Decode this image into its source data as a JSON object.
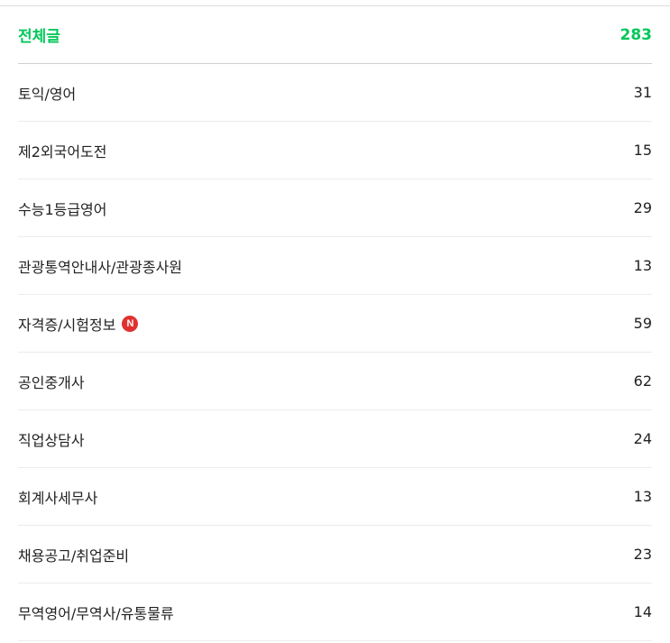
{
  "all_posts": {
    "label": "전체글",
    "count": "283"
  },
  "new_badge": "N",
  "accent_color": "#03c75a",
  "badge_color": "#e0312f",
  "categories": [
    {
      "label": "토익/영어",
      "count": "31"
    },
    {
      "label": "제2외국어도전",
      "count": "15"
    },
    {
      "label": "수능1등급영어",
      "count": "29"
    },
    {
      "label": "관광통역안내사/관광종사원",
      "count": "13"
    },
    {
      "label": "자격증/시험정보",
      "count": "59",
      "new": true
    },
    {
      "label": "공인중개사",
      "count": "62"
    },
    {
      "label": "직업상담사",
      "count": "24"
    },
    {
      "label": "회계사세무사",
      "count": "13"
    },
    {
      "label": "채용공고/취업준비",
      "count": "23"
    },
    {
      "label": "무역영어/무역사/유통물류",
      "count": "14"
    }
  ]
}
